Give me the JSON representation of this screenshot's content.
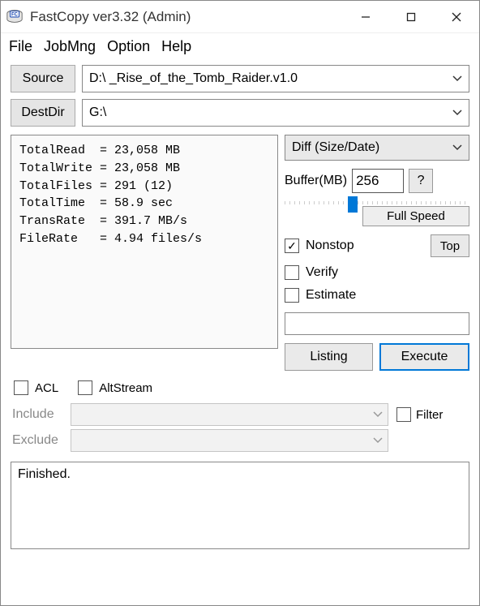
{
  "window": {
    "title": "FastCopy ver3.32 (Admin)"
  },
  "menu": {
    "file": "File",
    "jobmng": "JobMng",
    "option": "Option",
    "help": "Help"
  },
  "paths": {
    "source_btn": "Source",
    "source_val": "D:\\               _Rise_of_the_Tomb_Raider.v1.0",
    "dest_btn": "DestDir",
    "dest_val": "G:\\"
  },
  "stats": {
    "TotalRead": "23,058 MB",
    "TotalWrite": "23,058 MB",
    "TotalFiles": "291 (12)",
    "TotalTime": "58.9 sec",
    "TransRate": "391.7 MB/s",
    "FileRate": "4.94 files/s"
  },
  "mode_selected": "Diff (Size/Date)",
  "buffer": {
    "label": "Buffer(MB)",
    "value": "256",
    "help": "?"
  },
  "speed_label": "Full Speed",
  "checks": {
    "nonstop": {
      "label": "Nonstop",
      "checked": true
    },
    "verify": {
      "label": "Verify",
      "checked": false
    },
    "estimate": {
      "label": "Estimate",
      "checked": false
    }
  },
  "top_btn": "Top",
  "actions": {
    "listing": "Listing",
    "execute": "Execute"
  },
  "acl_label": "ACL",
  "altstream_label": "AltStream",
  "filter": {
    "include_lbl": "Include",
    "exclude_lbl": "Exclude",
    "filter_lbl": "Filter"
  },
  "log": "Finished."
}
